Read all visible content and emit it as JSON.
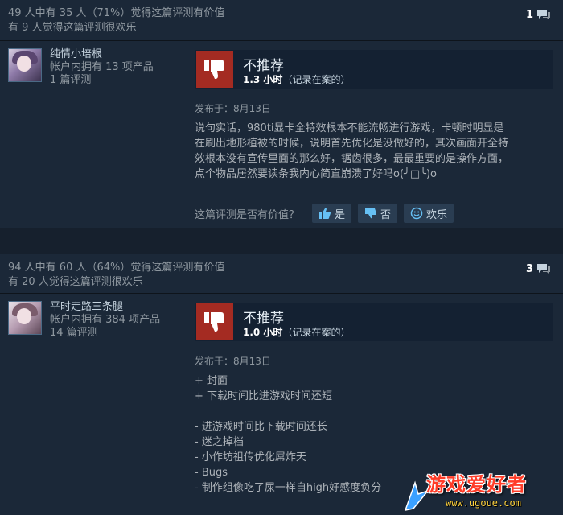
{
  "reviews": [
    {
      "helpful_line": "49 人中有 35 人（71%）觉得这篇评测有价值",
      "funny_line": "有 9 人觉得这篇评测很欢乐",
      "comment_count": "1",
      "author_name": "纯情小培根",
      "author_products": "帐户内拥有 13 项产品",
      "author_reviews": "1 篇评测",
      "verdict": "不推荐",
      "hours_value": "1.3 小时",
      "hours_suffix": "（记录在案的）",
      "posted": "发布于：8月13日",
      "body_lines": [
        "说句实话，980ti显卡全特效根本不能流畅进行游戏，卡顿时明显是",
        "在刷出地形植被的时候，说明首先优化是没做好的，其次画面开全特",
        "效根本没有宣传里面的那么好，锯齿很多，最最重要的是操作方面，",
        "点个物品居然要读条我内心简直崩溃了好吗o(╯□╰)o"
      ],
      "vote_question": "这篇评测是否有价值？",
      "vote_yes": "是",
      "vote_no": "否",
      "vote_funny": "欢乐"
    },
    {
      "helpful_line": "94 人中有 60 人（64%）觉得这篇评测有价值",
      "funny_line": "有 20 人觉得这篇评测很欢乐",
      "comment_count": "3",
      "author_name": "平时走路三条腿",
      "author_products": "帐户内拥有 384 项产品",
      "author_reviews": "14 篇评测",
      "verdict": "不推荐",
      "hours_value": "1.0 小时",
      "hours_suffix": "（记录在案的）",
      "posted": "发布于：8月13日",
      "body_lines": [
        "+ 封面",
        "+ 下载时间比进游戏时间还短",
        "",
        "- 进游戏时间比下载时间还长",
        "- 迷之掉档",
        "- 小作坊祖传优化屌炸天",
        "- Bugs",
        "- 制作组像吃了屎一样自high好感度负分"
      ]
    }
  ],
  "watermark": {
    "text": "游戏爱好者",
    "url": "www.ugoue.com"
  },
  "icons": {
    "comment": "comment-bubble-icon",
    "verdict": "thumbs-down-icon"
  },
  "colors": {
    "background": "#1b2838",
    "verdict_red": "#a42b22"
  }
}
